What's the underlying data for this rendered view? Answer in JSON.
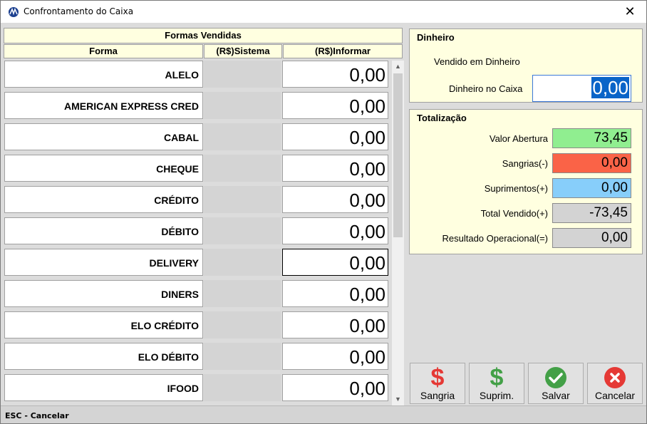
{
  "window": {
    "title": "Confrontamento do Caixa",
    "close_glyph": "✕"
  },
  "grid": {
    "title": "Formas Vendidas",
    "columns": {
      "forma": "Forma",
      "sistema": "(R$)Sistema",
      "informar": "(R$)Informar"
    },
    "rows": [
      {
        "forma": "ALELO",
        "informar": "0,00"
      },
      {
        "forma": "AMERICAN EXPRESS CRED",
        "informar": "0,00"
      },
      {
        "forma": "CABAL",
        "informar": "0,00"
      },
      {
        "forma": "CHEQUE",
        "informar": "0,00"
      },
      {
        "forma": "CRÉDITO",
        "informar": "0,00"
      },
      {
        "forma": "DÉBITO",
        "informar": "0,00"
      },
      {
        "forma": "DELIVERY",
        "informar": "0,00"
      },
      {
        "forma": "DINERS",
        "informar": "0,00"
      },
      {
        "forma": "ELO CRÉDITO",
        "informar": "0,00"
      },
      {
        "forma": "ELO DÉBITO",
        "informar": "0,00"
      },
      {
        "forma": "IFOOD",
        "informar": "0,00"
      }
    ],
    "scroll_up": "▲",
    "scroll_down": "▼"
  },
  "dinheiro": {
    "title": "Dinheiro",
    "vendido_label": "Vendido em Dinheiro",
    "caixa_label": "Dinheiro no Caixa",
    "caixa_value": "0,00"
  },
  "totalizacao": {
    "title": "Totalização",
    "items": [
      {
        "label": "Valor Abertura",
        "value": "73,45",
        "color": "#90ee90"
      },
      {
        "label": "Sangrias(-)",
        "value": "0,00",
        "color": "#fa6347"
      },
      {
        "label": "Suprimentos(+)",
        "value": "0,00",
        "color": "#87cefa"
      },
      {
        "label": "Total Vendido(+)",
        "value": "-73,45",
        "color": "#d3d3d3"
      },
      {
        "label": "Resultado Operacional(=)",
        "value": "0,00",
        "color": "#d3d3d3"
      }
    ]
  },
  "buttons": [
    {
      "label": "Sangria",
      "icon": "dollar-red-icon"
    },
    {
      "label": "Suprim.",
      "icon": "dollar-green-icon"
    },
    {
      "label": "Salvar",
      "icon": "check-circle-icon"
    },
    {
      "label": "Cancelar",
      "icon": "x-circle-icon"
    }
  ],
  "icons": {
    "dollar": "$"
  },
  "status": {
    "text": "ESC - Cancelar"
  }
}
